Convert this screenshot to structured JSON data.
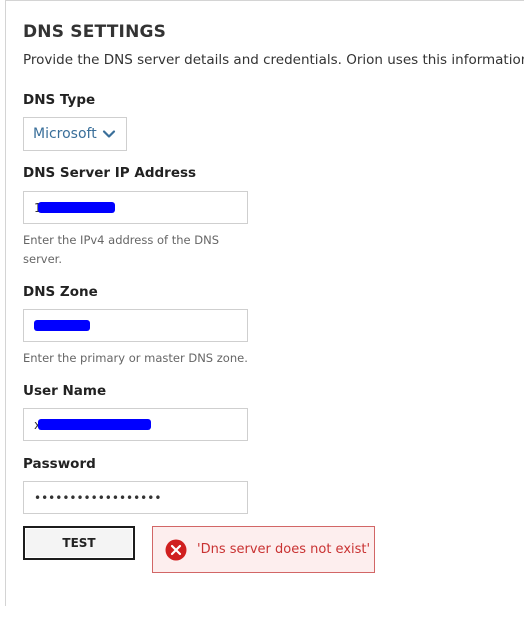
{
  "page": {
    "title": "DNS SETTINGS",
    "subtitle": "Provide the DNS server details and credentials. Orion uses this information to up"
  },
  "fields": {
    "dns_type": {
      "label": "DNS Type",
      "value": "Microsoft"
    },
    "server_ip": {
      "label": "DNS Server IP Address",
      "value": "1",
      "hint": "Enter the IPv4 address of the DNS server."
    },
    "zone": {
      "label": "DNS Zone",
      "value": "",
      "hint": "Enter the primary or master DNS zone."
    },
    "username": {
      "label": "User Name",
      "value": "x"
    },
    "password": {
      "label": "Password",
      "value": "••••••••••••••••••"
    }
  },
  "actions": {
    "test_label": "TEST"
  },
  "error": {
    "message": "'Dns server does not exist'"
  },
  "colors": {
    "link_blue": "#3a6f9a",
    "redaction": "#0000ff",
    "error_red": "#c93232",
    "error_bg": "#fdeeee"
  },
  "icons": {
    "dropdown": "chevron-down-icon",
    "error": "error-circle-icon"
  }
}
